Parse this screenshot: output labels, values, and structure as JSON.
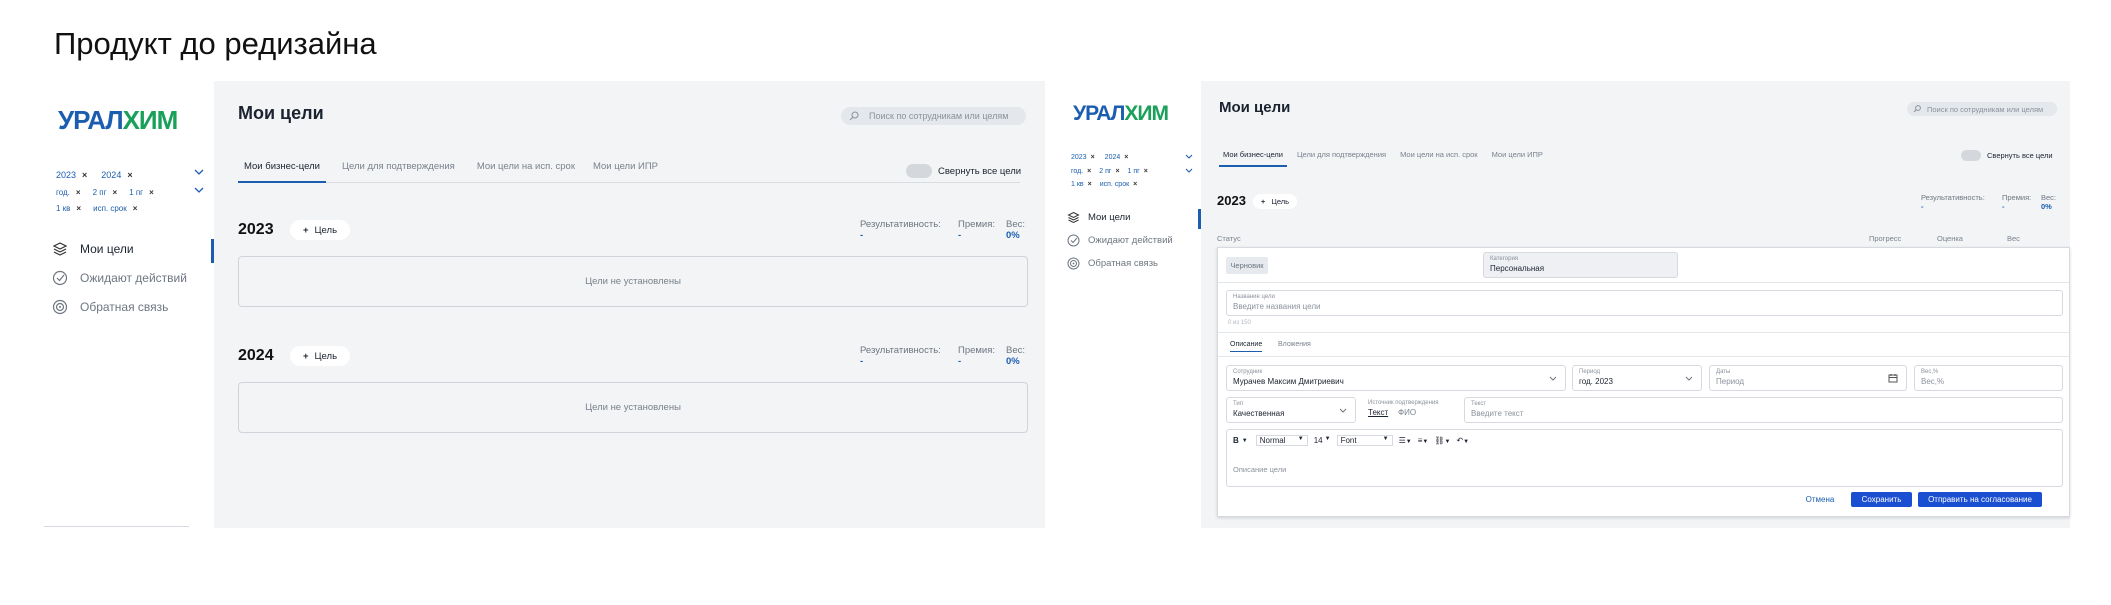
{
  "page_title": "Продукт до редизайна",
  "logo": {
    "part1": "УРАЛ",
    "part2": "ХИМ"
  },
  "colors": {
    "accent": "#1b5eb0",
    "primary_button": "#1b4fd1",
    "logo_green": "#19a05a"
  },
  "filters": {
    "row1": [
      "2023",
      "2024"
    ],
    "row2": [
      "год.",
      "2 пг",
      "1 пг"
    ],
    "row3": [
      "1 кв",
      "исп. срок"
    ],
    "remove_icon": "×"
  },
  "nav": [
    {
      "label": "Мои цели",
      "icon": "layers-icon"
    },
    {
      "label": "Ожидают действий",
      "icon": "check-circle-icon"
    },
    {
      "label": "Обратная связь",
      "icon": "target-icon"
    }
  ],
  "header": {
    "title": "Мои цели",
    "search_placeholder": "Поиск по сотрудникам или целям"
  },
  "tabs": [
    "Мои бизнес-цели",
    "Цели для подтверждения",
    "Мои цели на исп. срок",
    "Мои цели ИПР"
  ],
  "collapse_label": "Свернуть все цели",
  "add_goal": "Цель",
  "stats_labels": {
    "result": "Результативность:",
    "bonus": "Премия:",
    "weight": "Вес:"
  },
  "years": [
    {
      "year": "2023",
      "result": "-",
      "bonus": "-",
      "weight": "0%",
      "empty_text": "Цели не установлены"
    },
    {
      "year": "2024",
      "result": "-",
      "bonus": "-",
      "weight": "0%",
      "empty_text": "Цели не установлены"
    }
  ],
  "right": {
    "year": "2023",
    "result": "-",
    "bonus": "-",
    "weight": "0%",
    "columns": {
      "status": "Статус",
      "progress": "Прогресс",
      "score": "Оценка",
      "weight": "Вес"
    },
    "form": {
      "status_badge": "Черновик",
      "category_label": "Категория",
      "category_value": "Персональная",
      "name_label": "Название цели",
      "name_placeholder": "Введите названия цели",
      "char_counter": "0 из 150",
      "sub_tabs": [
        "Описание",
        "Вложения"
      ],
      "employee_label": "Сотрудник",
      "employee_value": "Мурачев Максим Дмитриевич",
      "period_label": "Период",
      "period_value": "год. 2023",
      "dates_label": "Даты",
      "dates_placeholder": "Период",
      "weight_label": "Вес,%",
      "weight_placeholder": "Вес,%",
      "type_label": "Тип",
      "type_value": "Качественная",
      "source_label": "Источник подтверждения",
      "source_options": [
        "Текст",
        "ФИО"
      ],
      "text_label": "Текст",
      "text_placeholder": "Введите текст",
      "toolbar": {
        "bold": "B",
        "style": "Normal",
        "size": "14",
        "font": "Font"
      },
      "editor_placeholder": "Описание цели",
      "cancel": "Отмена",
      "save": "Сохранить",
      "submit": "Отправить на согласование"
    }
  }
}
